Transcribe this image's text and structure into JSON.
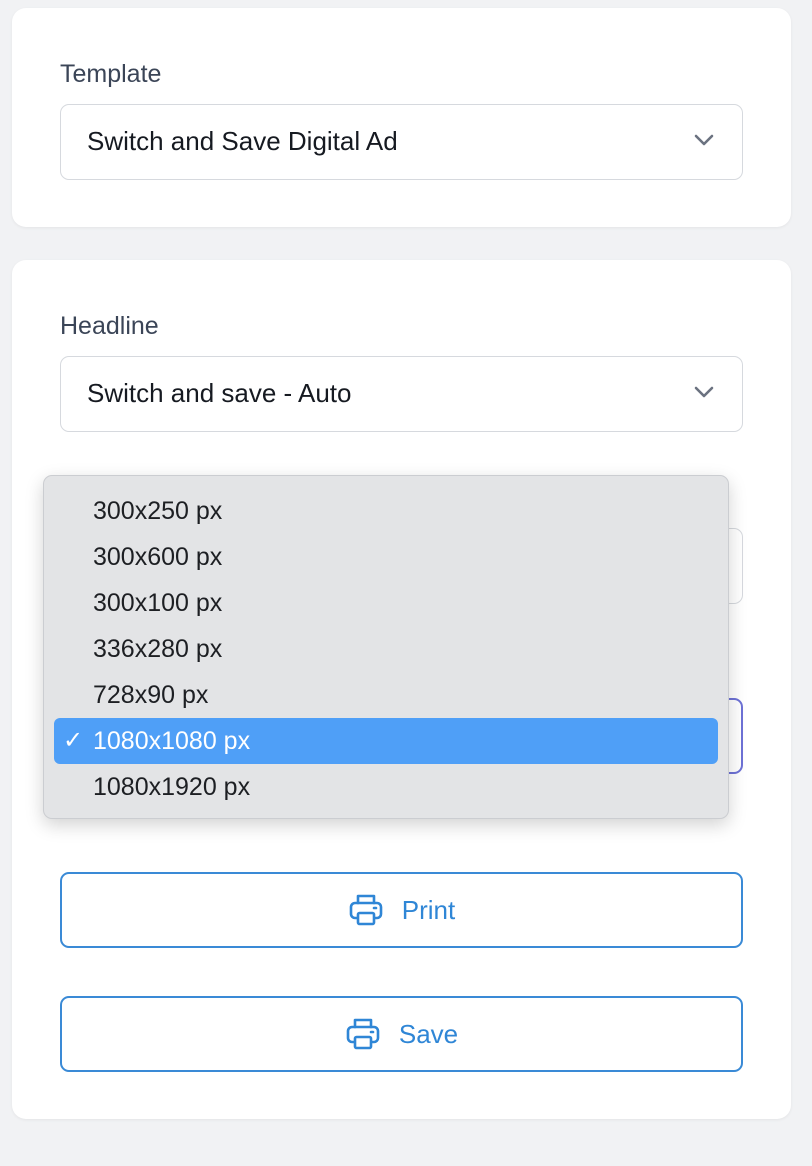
{
  "template_card": {
    "label": "Template",
    "selected": "Switch and Save Digital Ad"
  },
  "headline_card": {
    "label": "Headline",
    "selected": "Switch and save - Auto"
  },
  "size_dropdown": {
    "options": [
      "300x250 px",
      "300x600 px",
      "300x100 px",
      "336x280 px",
      "728x90 px",
      "1080x1080 px",
      "1080x1920 px"
    ],
    "selected_index": 5,
    "check_mark": "✓"
  },
  "buttons": {
    "print_label": "Print",
    "save_label": "Save",
    "icon": "printer-icon"
  },
  "colors": {
    "accent": "#2f86d6",
    "selection": "#4f9ff7",
    "focus_border": "#6e72d6",
    "page_bg": "#f1f2f4"
  }
}
